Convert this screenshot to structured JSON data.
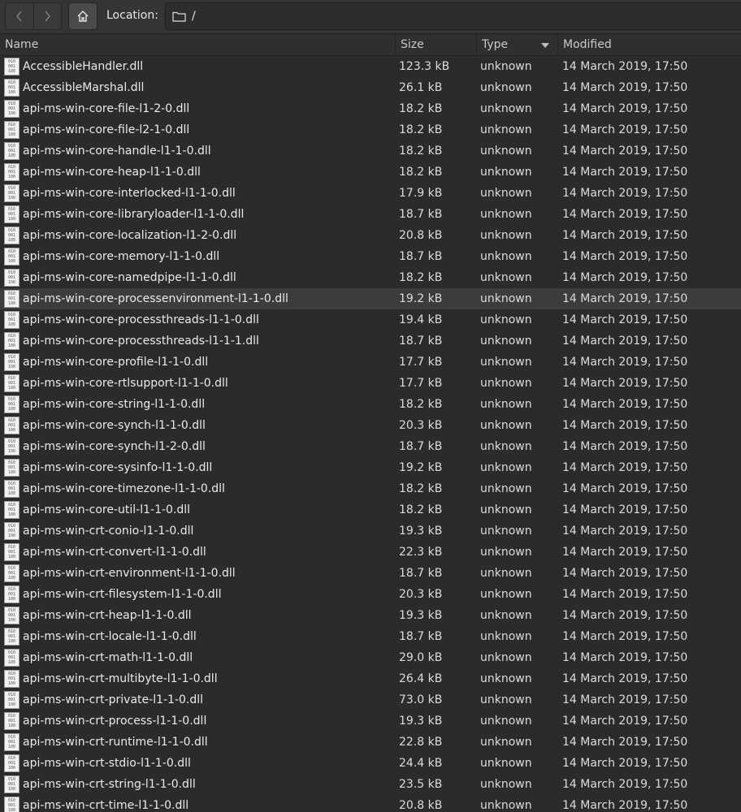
{
  "toolbar": {
    "back_icon": "chevron-left-icon",
    "forward_icon": "chevron-right-icon",
    "home_icon": "home-icon",
    "location_label": "Location:",
    "location_value": "/",
    "folder_icon": "folder-icon"
  },
  "columns": {
    "name": "Name",
    "size": "Size",
    "type": "Type",
    "modified": "Modified"
  },
  "files": [
    {
      "name": "AccessibleHandler.dll",
      "size": "123.3 kB",
      "type": "unknown",
      "modified": "14 March 2019, 17:50"
    },
    {
      "name": "AccessibleMarshal.dll",
      "size": "26.1 kB",
      "type": "unknown",
      "modified": "14 March 2019, 17:50"
    },
    {
      "name": "api-ms-win-core-file-l1-2-0.dll",
      "size": "18.2 kB",
      "type": "unknown",
      "modified": "14 March 2019, 17:50"
    },
    {
      "name": "api-ms-win-core-file-l2-1-0.dll",
      "size": "18.2 kB",
      "type": "unknown",
      "modified": "14 March 2019, 17:50"
    },
    {
      "name": "api-ms-win-core-handle-l1-1-0.dll",
      "size": "18.2 kB",
      "type": "unknown",
      "modified": "14 March 2019, 17:50"
    },
    {
      "name": "api-ms-win-core-heap-l1-1-0.dll",
      "size": "18.2 kB",
      "type": "unknown",
      "modified": "14 March 2019, 17:50"
    },
    {
      "name": "api-ms-win-core-interlocked-l1-1-0.dll",
      "size": "17.9 kB",
      "type": "unknown",
      "modified": "14 March 2019, 17:50"
    },
    {
      "name": "api-ms-win-core-libraryloader-l1-1-0.dll",
      "size": "18.7 kB",
      "type": "unknown",
      "modified": "14 March 2019, 17:50"
    },
    {
      "name": "api-ms-win-core-localization-l1-2-0.dll",
      "size": "20.8 kB",
      "type": "unknown",
      "modified": "14 March 2019, 17:50"
    },
    {
      "name": "api-ms-win-core-memory-l1-1-0.dll",
      "size": "18.7 kB",
      "type": "unknown",
      "modified": "14 March 2019, 17:50"
    },
    {
      "name": "api-ms-win-core-namedpipe-l1-1-0.dll",
      "size": "18.2 kB",
      "type": "unknown",
      "modified": "14 March 2019, 17:50"
    },
    {
      "name": "api-ms-win-core-processenvironment-l1-1-0.dll",
      "size": "19.2 kB",
      "type": "unknown",
      "modified": "14 March 2019, 17:50",
      "highlighted": true
    },
    {
      "name": "api-ms-win-core-processthreads-l1-1-0.dll",
      "size": "19.4 kB",
      "type": "unknown",
      "modified": "14 March 2019, 17:50"
    },
    {
      "name": "api-ms-win-core-processthreads-l1-1-1.dll",
      "size": "18.7 kB",
      "type": "unknown",
      "modified": "14 March 2019, 17:50"
    },
    {
      "name": "api-ms-win-core-profile-l1-1-0.dll",
      "size": "17.7 kB",
      "type": "unknown",
      "modified": "14 March 2019, 17:50"
    },
    {
      "name": "api-ms-win-core-rtlsupport-l1-1-0.dll",
      "size": "17.7 kB",
      "type": "unknown",
      "modified": "14 March 2019, 17:50"
    },
    {
      "name": "api-ms-win-core-string-l1-1-0.dll",
      "size": "18.2 kB",
      "type": "unknown",
      "modified": "14 March 2019, 17:50"
    },
    {
      "name": "api-ms-win-core-synch-l1-1-0.dll",
      "size": "20.3 kB",
      "type": "unknown",
      "modified": "14 March 2019, 17:50"
    },
    {
      "name": "api-ms-win-core-synch-l1-2-0.dll",
      "size": "18.7 kB",
      "type": "unknown",
      "modified": "14 March 2019, 17:50"
    },
    {
      "name": "api-ms-win-core-sysinfo-l1-1-0.dll",
      "size": "19.2 kB",
      "type": "unknown",
      "modified": "14 March 2019, 17:50"
    },
    {
      "name": "api-ms-win-core-timezone-l1-1-0.dll",
      "size": "18.2 kB",
      "type": "unknown",
      "modified": "14 March 2019, 17:50"
    },
    {
      "name": "api-ms-win-core-util-l1-1-0.dll",
      "size": "18.2 kB",
      "type": "unknown",
      "modified": "14 March 2019, 17:50"
    },
    {
      "name": "api-ms-win-crt-conio-l1-1-0.dll",
      "size": "19.3 kB",
      "type": "unknown",
      "modified": "14 March 2019, 17:50"
    },
    {
      "name": "api-ms-win-crt-convert-l1-1-0.dll",
      "size": "22.3 kB",
      "type": "unknown",
      "modified": "14 March 2019, 17:50"
    },
    {
      "name": "api-ms-win-crt-environment-l1-1-0.dll",
      "size": "18.7 kB",
      "type": "unknown",
      "modified": "14 March 2019, 17:50"
    },
    {
      "name": "api-ms-win-crt-filesystem-l1-1-0.dll",
      "size": "20.3 kB",
      "type": "unknown",
      "modified": "14 March 2019, 17:50"
    },
    {
      "name": "api-ms-win-crt-heap-l1-1-0.dll",
      "size": "19.3 kB",
      "type": "unknown",
      "modified": "14 March 2019, 17:50"
    },
    {
      "name": "api-ms-win-crt-locale-l1-1-0.dll",
      "size": "18.7 kB",
      "type": "unknown",
      "modified": "14 March 2019, 17:50"
    },
    {
      "name": "api-ms-win-crt-math-l1-1-0.dll",
      "size": "29.0 kB",
      "type": "unknown",
      "modified": "14 March 2019, 17:50"
    },
    {
      "name": "api-ms-win-crt-multibyte-l1-1-0.dll",
      "size": "26.4 kB",
      "type": "unknown",
      "modified": "14 March 2019, 17:50"
    },
    {
      "name": "api-ms-win-crt-private-l1-1-0.dll",
      "size": "73.0 kB",
      "type": "unknown",
      "modified": "14 March 2019, 17:50"
    },
    {
      "name": "api-ms-win-crt-process-l1-1-0.dll",
      "size": "19.3 kB",
      "type": "unknown",
      "modified": "14 March 2019, 17:50"
    },
    {
      "name": "api-ms-win-crt-runtime-l1-1-0.dll",
      "size": "22.8 kB",
      "type": "unknown",
      "modified": "14 March 2019, 17:50"
    },
    {
      "name": "api-ms-win-crt-stdio-l1-1-0.dll",
      "size": "24.4 kB",
      "type": "unknown",
      "modified": "14 March 2019, 17:50"
    },
    {
      "name": "api-ms-win-crt-string-l1-1-0.dll",
      "size": "23.5 kB",
      "type": "unknown",
      "modified": "14 March 2019, 17:50"
    },
    {
      "name": "api-ms-win-crt-time-l1-1-0.dll",
      "size": "20.8 kB",
      "type": "unknown",
      "modified": "14 March 2019, 17:50"
    }
  ]
}
